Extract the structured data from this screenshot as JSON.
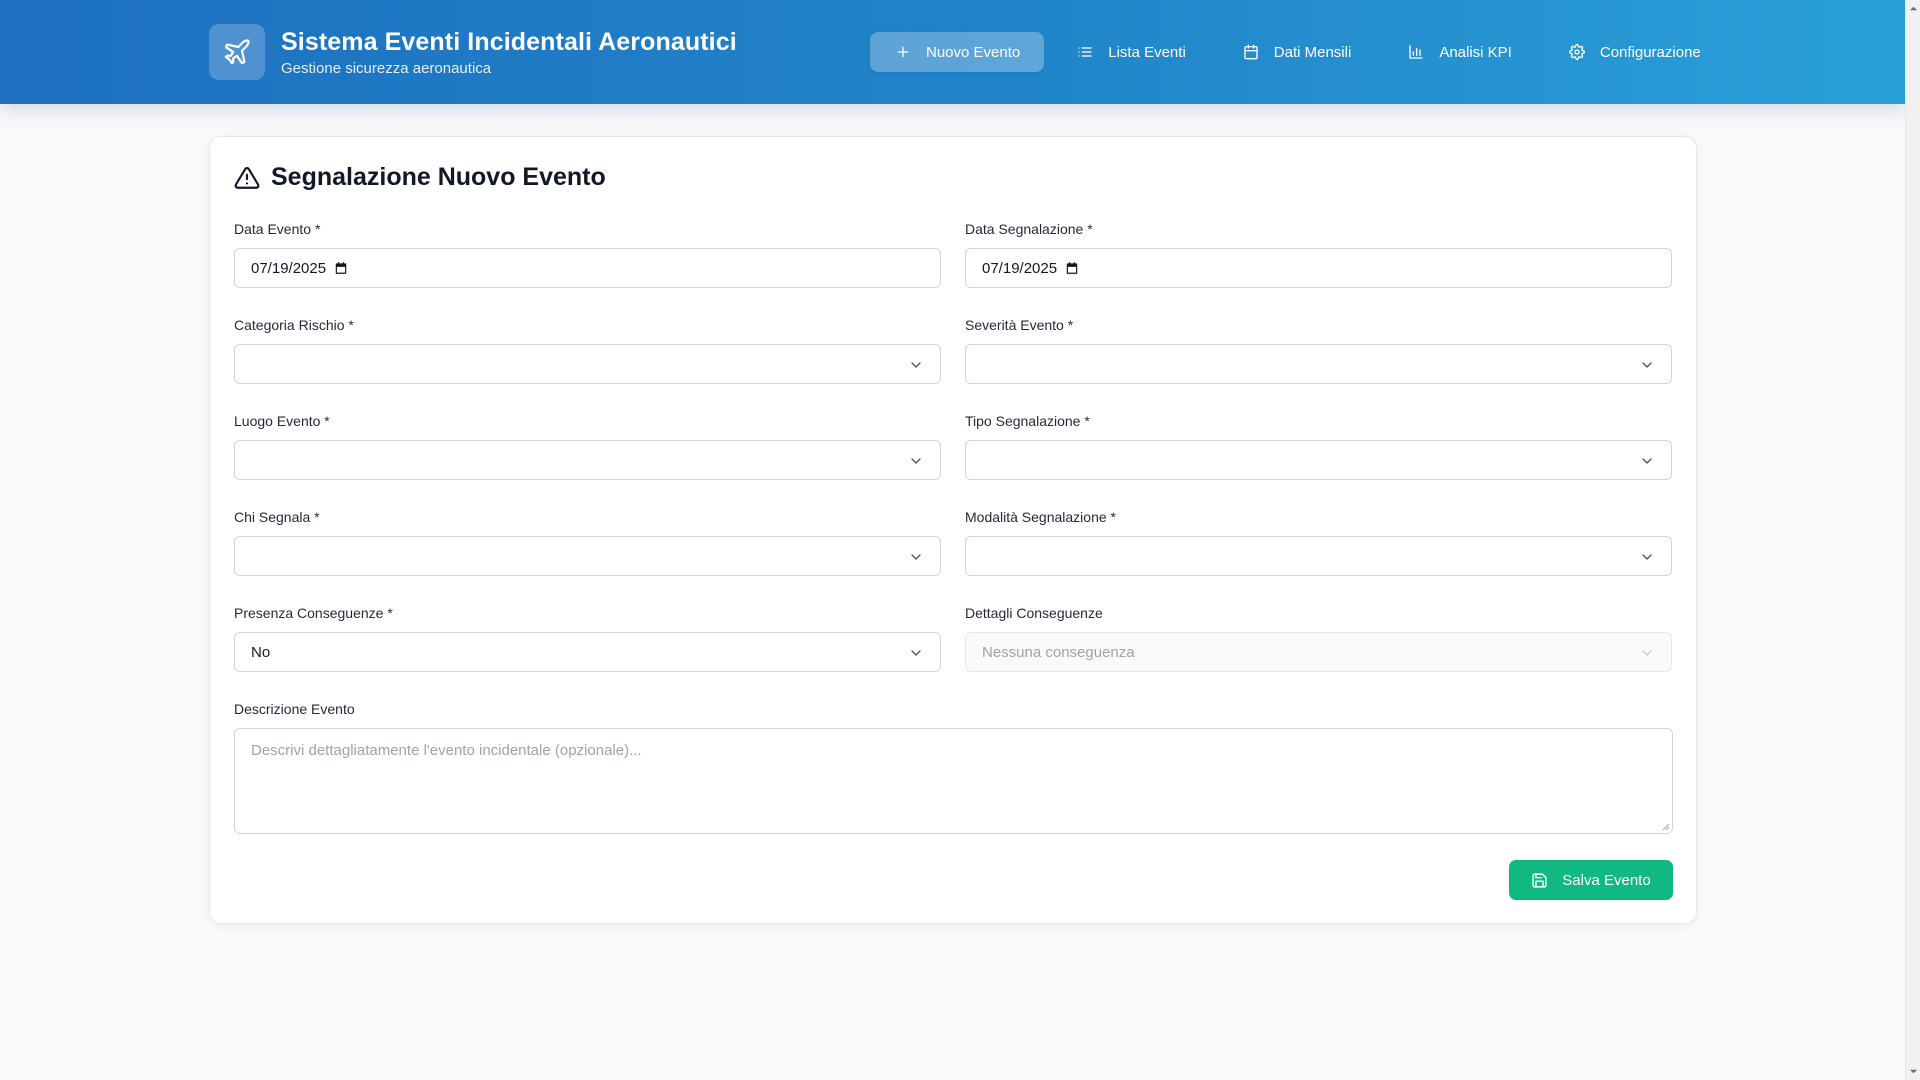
{
  "app": {
    "title": "Sistema Eventi Incidentali Aeronautici",
    "subtitle": "Gestione sicurezza aeronautica",
    "logo_icon": "airplane-icon"
  },
  "nav": {
    "items": [
      {
        "label": "Nuovo Evento",
        "icon": "plus-icon",
        "active": true
      },
      {
        "label": "Lista Eventi",
        "icon": "list-icon",
        "active": false
      },
      {
        "label": "Dati Mensili",
        "icon": "calendar-icon",
        "active": false
      },
      {
        "label": "Analisi KPI",
        "icon": "bar-chart-icon",
        "active": false
      },
      {
        "label": "Configurazione",
        "icon": "gear-icon",
        "active": false
      }
    ]
  },
  "form": {
    "title": "Segnalazione Nuovo Evento",
    "title_icon": "warning-icon",
    "data_evento": {
      "label": "Data Evento *",
      "value": "07/19/2025"
    },
    "data_segnalazione": {
      "label": "Data Segnalazione *",
      "value": "07/19/2025"
    },
    "categoria_rischio": {
      "label": "Categoria Rischio *",
      "value": ""
    },
    "severita_evento": {
      "label": "Severità Evento *",
      "value": ""
    },
    "luogo_evento": {
      "label": "Luogo Evento *",
      "value": ""
    },
    "tipo_segnalazione": {
      "label": "Tipo Segnalazione *",
      "value": ""
    },
    "chi_segnala": {
      "label": "Chi Segnala *",
      "value": ""
    },
    "modalita_segnalazione": {
      "label": "Modalità Segnalazione *",
      "value": ""
    },
    "presenza_conseguenze": {
      "label": "Presenza Conseguenze *",
      "value": "No"
    },
    "dettagli_conseguenze": {
      "label": "Dettagli Conseguenze",
      "value": "Nessuna conseguenza",
      "disabled": true
    },
    "descrizione": {
      "label": "Descrizione Evento",
      "placeholder": "Descrivi dettagliatamente l'evento incidentale (opzionale)..."
    },
    "save_label": "Salva Evento"
  },
  "colors": {
    "header_start": "#1d6fc0",
    "header_end": "#2aa0d8",
    "save_button": "#10b981"
  }
}
